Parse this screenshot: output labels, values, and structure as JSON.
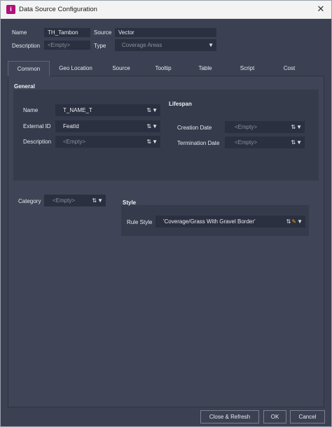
{
  "window": {
    "title": "Data Source Configuration"
  },
  "header": {
    "name_label": "Name",
    "name_value": "TH_Tambon",
    "source_label": "Source",
    "source_value": "Vector",
    "description_label": "Description",
    "description_placeholder": "<Empty>",
    "type_label": "Type",
    "type_value": "Coverage Areas"
  },
  "tabs": [
    "Common",
    "Geo Location",
    "Source",
    "Tooltip",
    "Table",
    "Script",
    "Cost"
  ],
  "active_tab": "Common",
  "general": {
    "title": "General",
    "name_label": "Name",
    "name_value": "T_NAME_T",
    "external_id_label": "External ID",
    "external_id_value": "FeatId",
    "description_label": "Description",
    "description_value": "<Empty>"
  },
  "lifespan": {
    "title": "Lifespan",
    "creation_label": "Creation Date",
    "creation_value": "<Empty>",
    "termination_label": "Termination Date",
    "termination_value": "<Empty>"
  },
  "category": {
    "label": "Category",
    "value": "<Empty>"
  },
  "style": {
    "title": "Style",
    "rule_label": "Rule Style",
    "rule_value": "'Coverage/Grass With Gravel Border'"
  },
  "buttons": {
    "close_refresh": "Close & Refresh",
    "ok": "OK",
    "cancel": "Cancel"
  },
  "icons": {
    "app": "app-icon",
    "close": "close-icon",
    "field_expr": "field-expression-icon",
    "dropdown": "chevron-down-icon",
    "edit": "pencil-icon"
  },
  "colors": {
    "background": "#3b4152",
    "panel": "#3f4556",
    "group": "#353b4b",
    "field": "#2b3040",
    "app_icon": "#b0107a"
  }
}
